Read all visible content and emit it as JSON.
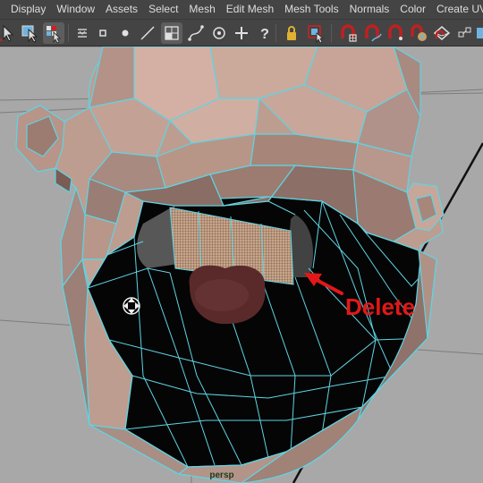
{
  "menubar": {
    "items": [
      "Display",
      "Window",
      "Assets",
      "Select",
      "Mesh",
      "Edit Mesh",
      "Mesh Tools",
      "Normals",
      "Color",
      "Create UVs"
    ]
  },
  "toolbar": {
    "icons": [
      "select-tool-icon",
      "lasso-select-icon",
      "paint-select-icon",
      "soft-select-icon",
      "vertex-mode-icon",
      "object-mode-icon",
      "multi-component-icon",
      "face-mode-icon",
      "uv-mode-icon",
      "move-tool-icon",
      "help-icon",
      "lock-icon",
      "highlight-icon",
      "snap-to-grid-icon",
      "snap-to-curve-icon",
      "snap-to-point-icon",
      "snap-to-view-icon",
      "snap-to-surface-icon",
      "make-live-icon"
    ]
  },
  "viewport": {
    "camera_label": "persp"
  },
  "annotation": {
    "label": "Delete",
    "color": "#e21818"
  },
  "colors": {
    "mesh_skin": "#bd9d90",
    "wireframe": "#5fd4e4",
    "interior": "#050505",
    "mouth_grid": "#c9a58a",
    "tongue": "#5a2a2b",
    "viewport_bg": "#a8a8a8",
    "menu_bg": "#444444"
  }
}
